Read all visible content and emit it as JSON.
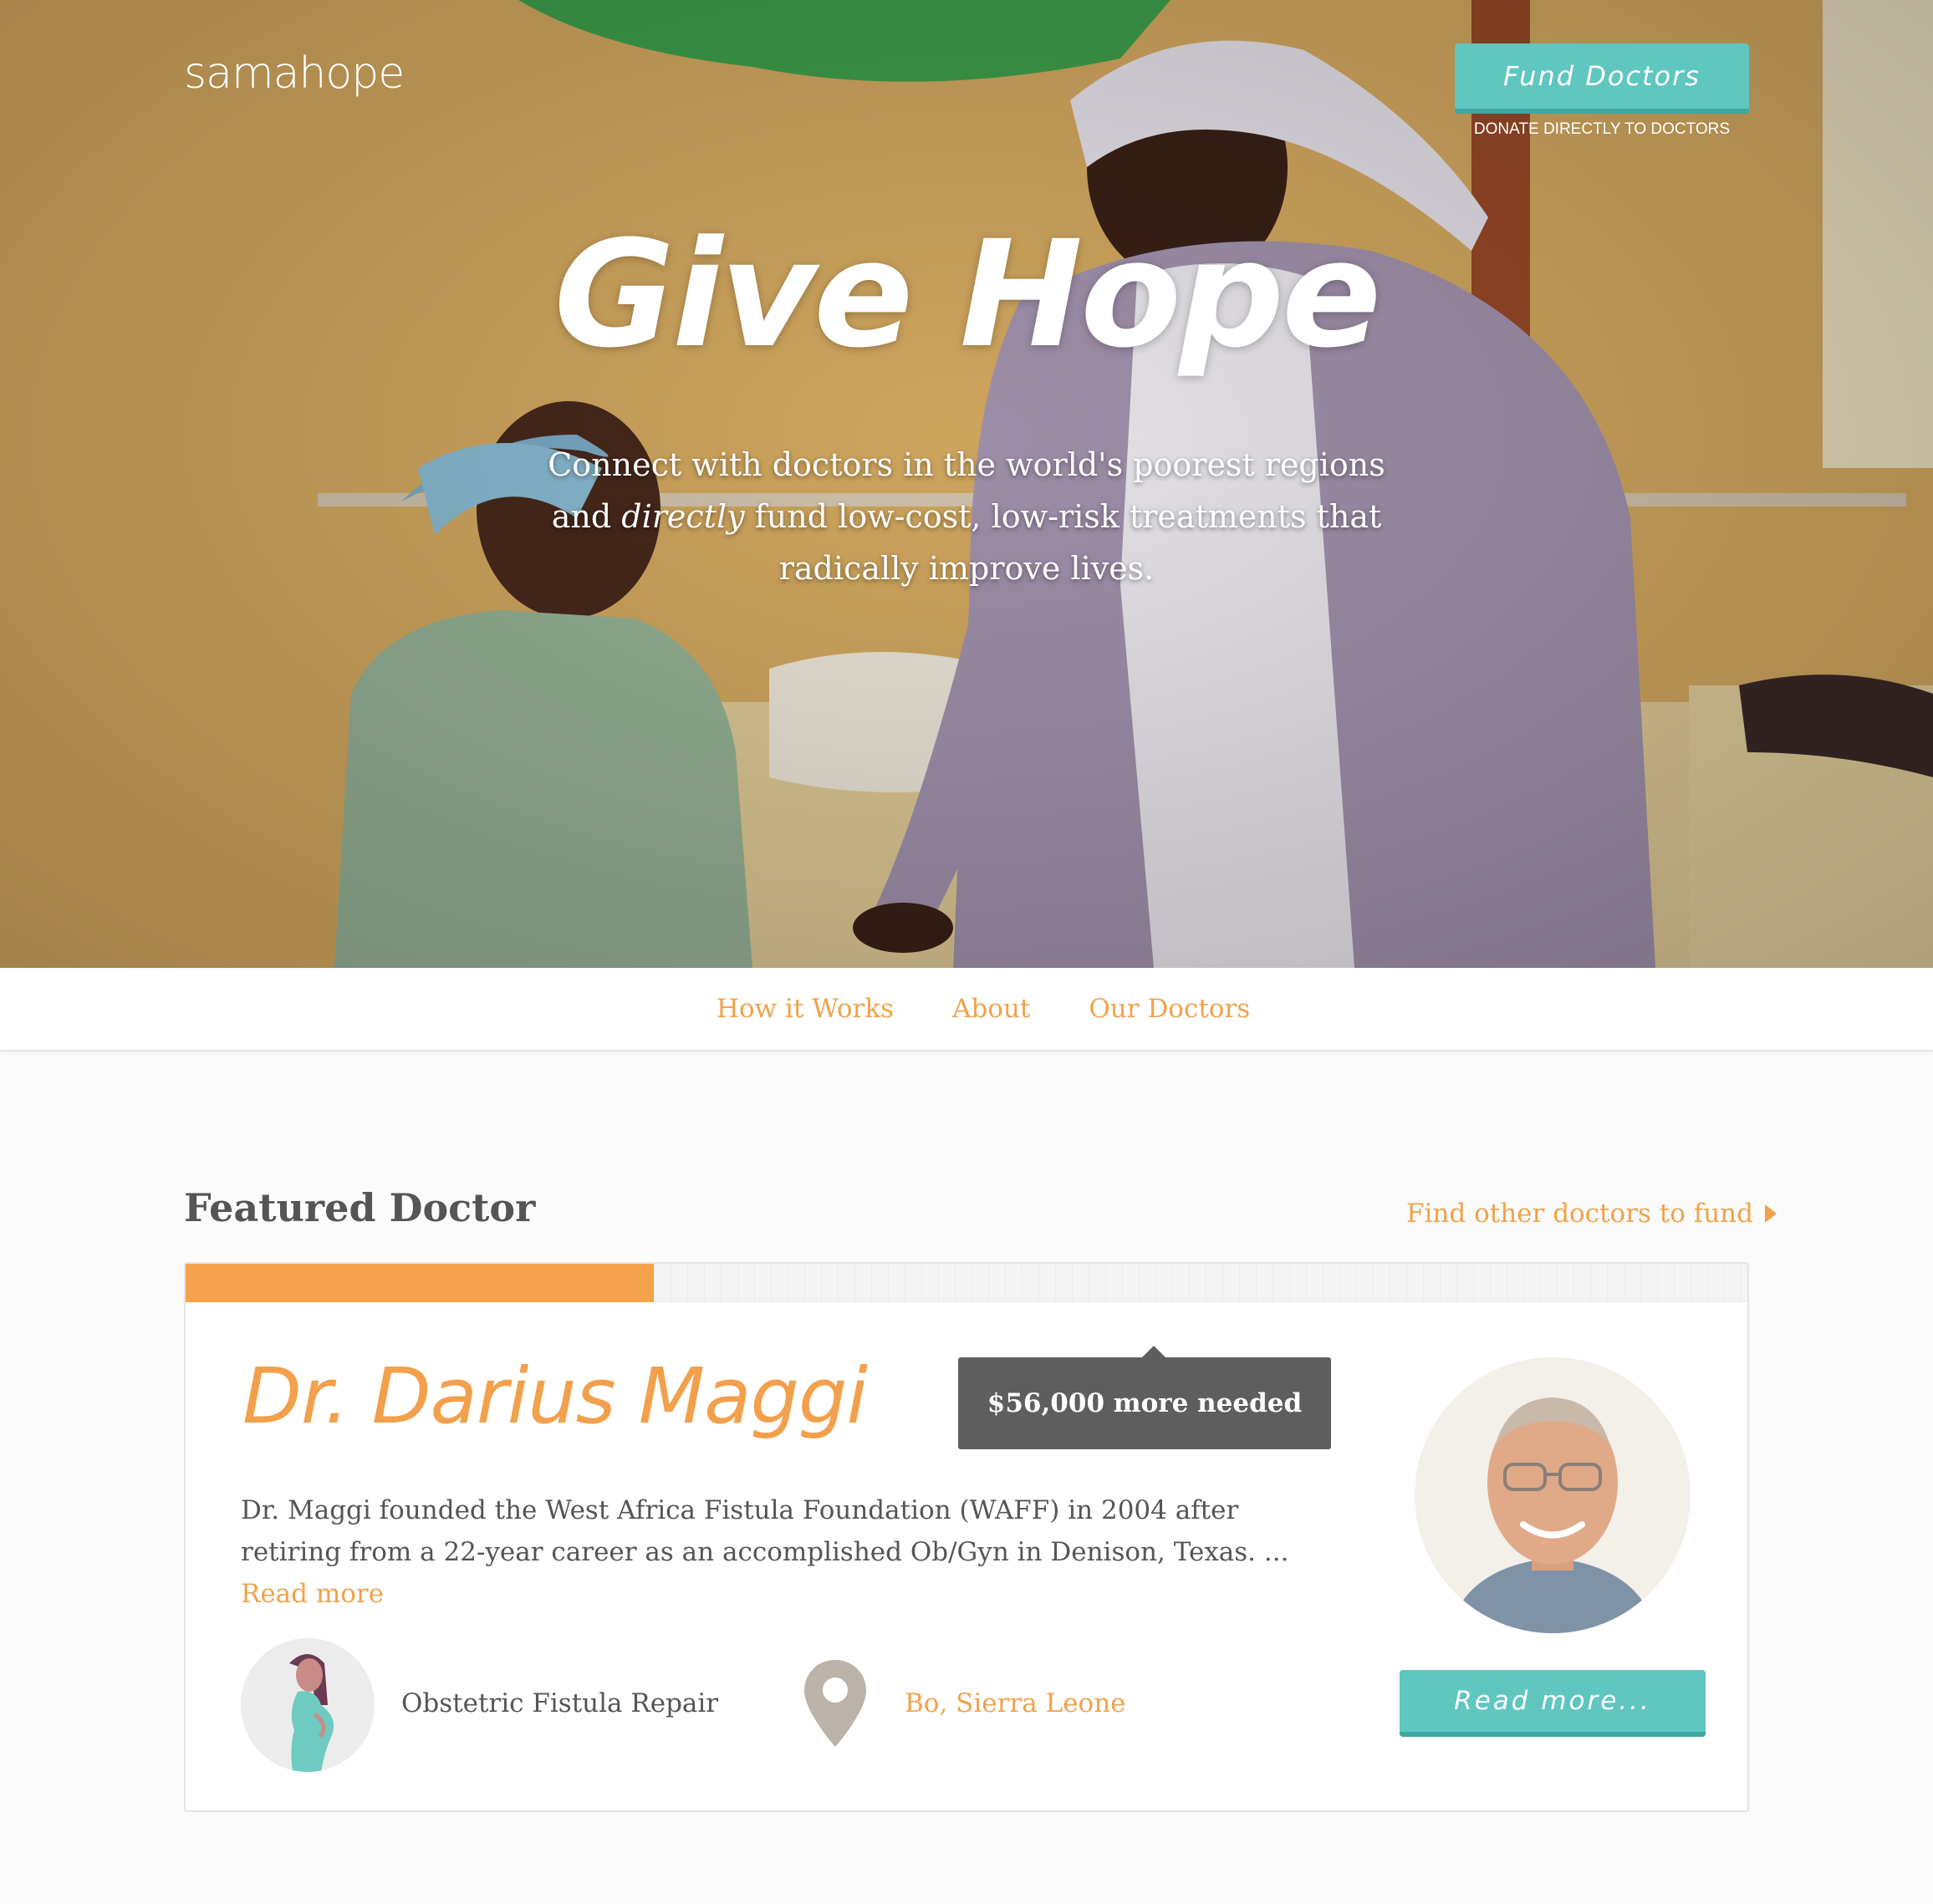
{
  "header": {
    "logo": "samahope",
    "fund_button": "Fund Doctors",
    "fund_sub": "DONATE DIRECTLY TO DOCTORS"
  },
  "hero": {
    "title": "Give Hope",
    "subtitle_pre": "Connect with doctors in the world's poorest regions and ",
    "subtitle_em": "directly",
    "subtitle_post": " fund low-cost, low-risk treatments that radically improve lives."
  },
  "nav": {
    "items": [
      "How it Works",
      "About",
      "Our Doctors"
    ]
  },
  "featured": {
    "heading": "Featured Doctor",
    "find_link": "Find other doctors to fund",
    "funded_fraction": 0.3,
    "doctor_name": "Dr. Darius Maggi",
    "needed": "$56,000 more needed",
    "bio": "Dr. Maggi founded the West Africa Fistula Foundation (WAFF) in 2004 after retiring from a 22-year career as an accomplished Ob/Gyn in Denison, Texas. ...",
    "bio_more": "Read more",
    "treatment": "Obstetric Fistula Repair",
    "location": "Bo, Sierra Leone",
    "read_button": "Read more...",
    "icons": {
      "treatment": "pregnant-woman-icon",
      "location": "map-pin-icon"
    }
  },
  "colors": {
    "accent_orange": "#f0a24b",
    "button_teal": "#5fc6c0",
    "tooltip_gray": "#5e5e5e"
  }
}
